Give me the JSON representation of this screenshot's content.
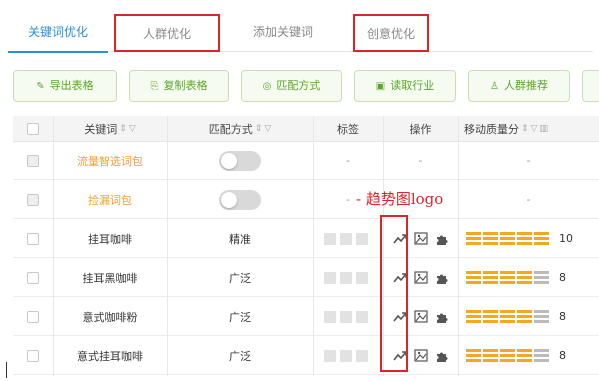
{
  "tabs": [
    {
      "label": "关键词优化",
      "active": true,
      "annotated": true
    },
    {
      "label": "人群优化",
      "active": false,
      "annotated": true
    },
    {
      "label": "添加关键词",
      "active": false,
      "annotated": false
    },
    {
      "label": "创意优化",
      "active": false,
      "annotated": true
    }
  ],
  "toolbar": [
    {
      "icon": "paperclip-icon",
      "glyph": "✎",
      "label": "导出表格"
    },
    {
      "icon": "copy-icon",
      "glyph": "⎘",
      "label": "复制表格"
    },
    {
      "icon": "match-icon",
      "glyph": "◎",
      "label": "匹配方式"
    },
    {
      "icon": "industry-icon",
      "glyph": "▣",
      "label": "读取行业"
    },
    {
      "icon": "user-icon",
      "glyph": "♙",
      "label": "人群推荐"
    }
  ],
  "table": {
    "headers": {
      "keyword": "关键词",
      "match": "匹配方式",
      "tags": "标签",
      "ops": "操作",
      "quality": "移动质量分"
    },
    "rows": [
      {
        "keyword": "流量智选词包",
        "keyword_style": "orange",
        "match": "",
        "match_toggle": true,
        "tags": "-",
        "ops": "-",
        "quality": "-",
        "score": ""
      },
      {
        "keyword": "捡漏词包",
        "keyword_style": "orange",
        "match": "",
        "match_toggle": true,
        "tags": "-",
        "ops": "",
        "quality": "-",
        "score": ""
      },
      {
        "keyword": "挂耳咖啡",
        "keyword_style": "normal",
        "match": "精准",
        "match_toggle": false,
        "tags": "",
        "ops": "icons",
        "quality": "bars",
        "score": "10"
      },
      {
        "keyword": "挂耳黑咖啡",
        "keyword_style": "normal",
        "match": "广泛",
        "match_toggle": false,
        "tags": "",
        "ops": "icons",
        "quality": "bars",
        "score": "8"
      },
      {
        "keyword": "意式咖啡粉",
        "keyword_style": "normal",
        "match": "广泛",
        "match_toggle": false,
        "tags": "",
        "ops": "icons",
        "quality": "bars",
        "score": "8"
      },
      {
        "keyword": "意式挂耳咖啡",
        "keyword_style": "normal",
        "match": "广泛",
        "match_toggle": false,
        "tags": "",
        "ops": "icons",
        "quality": "bars",
        "score": "8"
      }
    ]
  },
  "annotation": {
    "label": "- 趋势图logo"
  },
  "colors": {
    "accent": "#2a8fd6",
    "green": "#5aa527",
    "orange": "#f0a030",
    "annotation_red": "#d9262a"
  }
}
